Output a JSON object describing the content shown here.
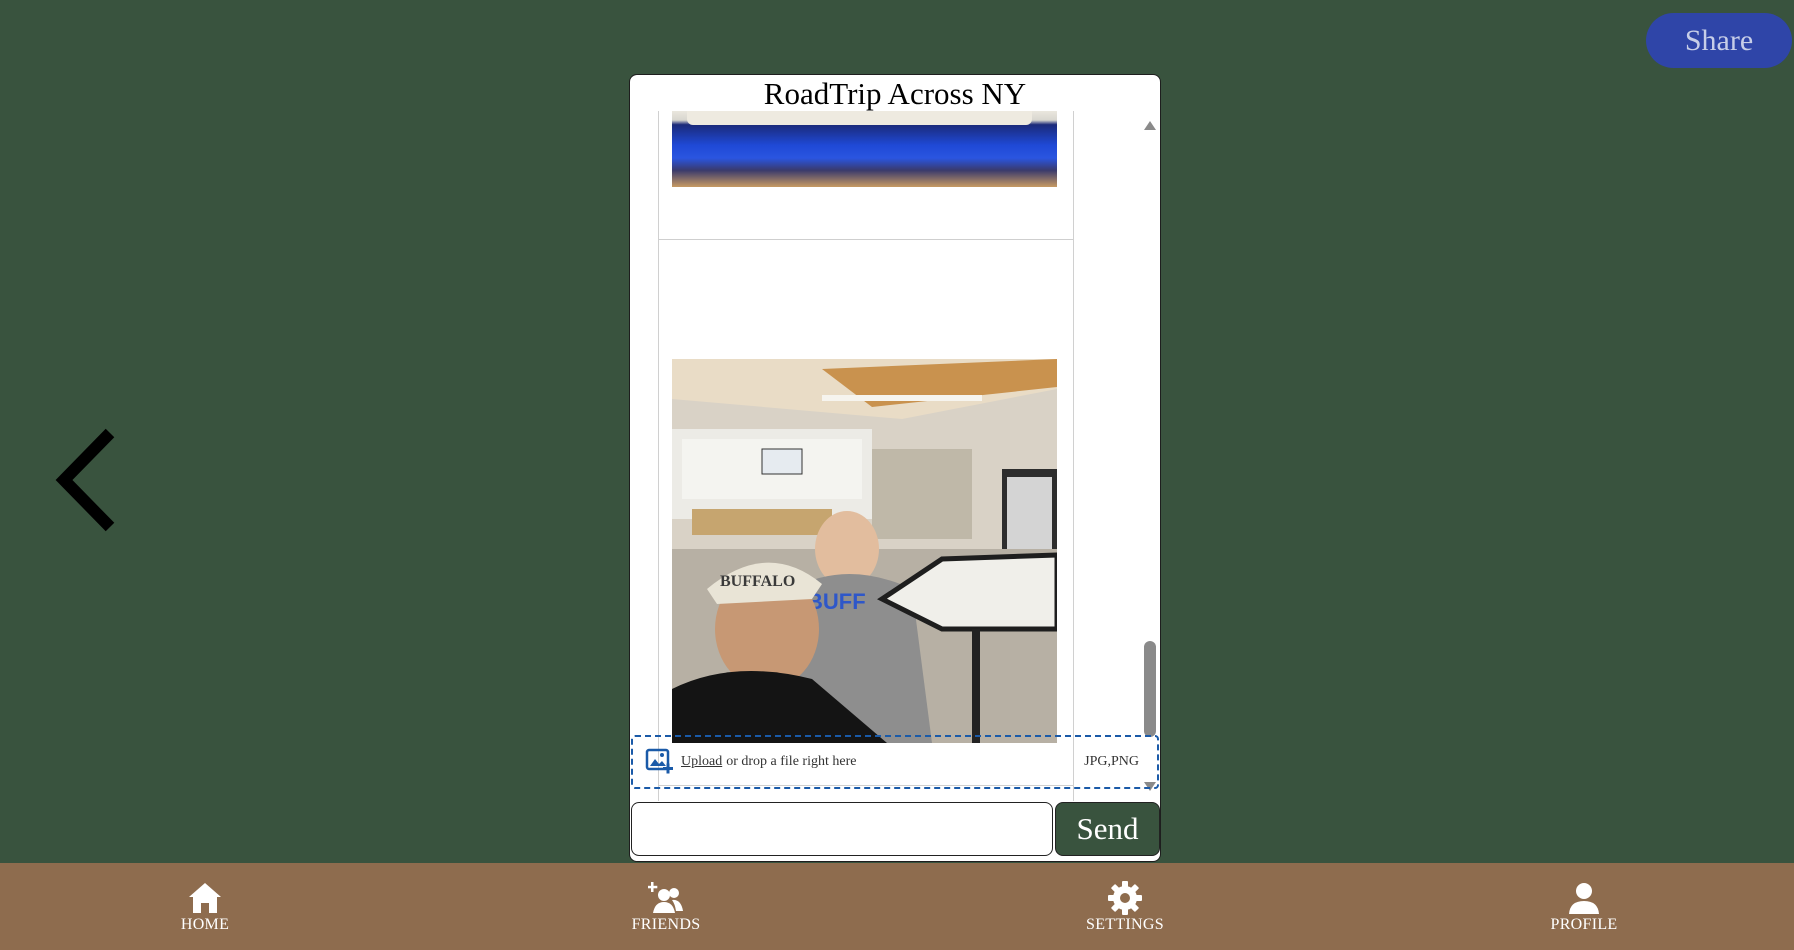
{
  "header": {
    "share_label": "Share"
  },
  "chat": {
    "title": "RoadTrip Across NY",
    "upload": {
      "upload_link": "Upload",
      "drop_text": "or drop a file right here",
      "file_types": "JPG,PNG"
    },
    "message_input": {
      "value": "",
      "placeholder": ""
    },
    "send_label": "Send"
  },
  "nav": {
    "items": [
      {
        "label": "HOME",
        "icon": "home-icon"
      },
      {
        "label": "FRIENDS",
        "icon": "add-friend-icon"
      },
      {
        "label": "SETTINGS",
        "icon": "gear-icon"
      },
      {
        "label": "PROFILE",
        "icon": "person-icon"
      }
    ]
  },
  "colors": {
    "background": "#39533e",
    "share_button": "#2f45a8",
    "nav_bar": "#8e6c4e",
    "send_button": "#39533e",
    "dropzone_border": "#1a5aa8"
  }
}
